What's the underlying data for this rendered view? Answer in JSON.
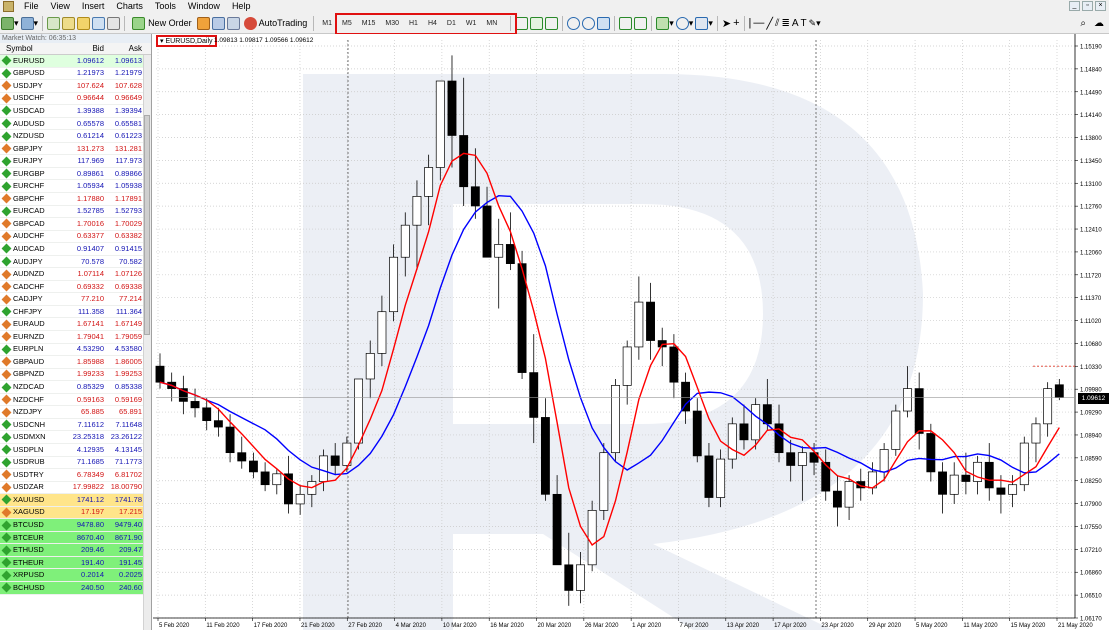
{
  "menu": [
    "File",
    "View",
    "Insert",
    "Charts",
    "Tools",
    "Window",
    "Help"
  ],
  "toolbar": {
    "new_order": "New Order",
    "autotrading": "AutoTrading",
    "timeframes": [
      "M1",
      "M5",
      "M15",
      "M30",
      "H1",
      "H4",
      "D1",
      "W1",
      "MN"
    ]
  },
  "market_watch": {
    "title": "Market Watch: 06:35:13",
    "columns": [
      "Symbol",
      "Bid",
      "Ask"
    ],
    "rows": [
      {
        "symbol": "EURUSD",
        "bid": "1.09612",
        "ask": "1.09613",
        "dir": "up"
      },
      {
        "symbol": "GBPUSD",
        "bid": "1.21973",
        "ask": "1.21979",
        "dir": "up"
      },
      {
        "symbol": "USDJPY",
        "bid": "107.624",
        "ask": "107.628",
        "dir": "down"
      },
      {
        "symbol": "USDCHF",
        "bid": "0.96644",
        "ask": "0.96649",
        "dir": "down"
      },
      {
        "symbol": "USDCAD",
        "bid": "1.39388",
        "ask": "1.39394",
        "dir": "up"
      },
      {
        "symbol": "AUDUSD",
        "bid": "0.65578",
        "ask": "0.65581",
        "dir": "up"
      },
      {
        "symbol": "NZDUSD",
        "bid": "0.61214",
        "ask": "0.61223",
        "dir": "up"
      },
      {
        "symbol": "GBPJPY",
        "bid": "131.273",
        "ask": "131.281",
        "dir": "down"
      },
      {
        "symbol": "EURJPY",
        "bid": "117.969",
        "ask": "117.973",
        "dir": "up"
      },
      {
        "symbol": "EURGBP",
        "bid": "0.89861",
        "ask": "0.89866",
        "dir": "up"
      },
      {
        "symbol": "EURCHF",
        "bid": "1.05934",
        "ask": "1.05938",
        "dir": "up"
      },
      {
        "symbol": "GBPCHF",
        "bid": "1.17880",
        "ask": "1.17891",
        "dir": "down"
      },
      {
        "symbol": "EURCAD",
        "bid": "1.52785",
        "ask": "1.52793",
        "dir": "up"
      },
      {
        "symbol": "GBPCAD",
        "bid": "1.70016",
        "ask": "1.70029",
        "dir": "down"
      },
      {
        "symbol": "AUDCHF",
        "bid": "0.63377",
        "ask": "0.63382",
        "dir": "down"
      },
      {
        "symbol": "AUDCAD",
        "bid": "0.91407",
        "ask": "0.91415",
        "dir": "up"
      },
      {
        "symbol": "AUDJPY",
        "bid": "70.578",
        "ask": "70.582",
        "dir": "up"
      },
      {
        "symbol": "AUDNZD",
        "bid": "1.07114",
        "ask": "1.07126",
        "dir": "down"
      },
      {
        "symbol": "CADCHF",
        "bid": "0.69332",
        "ask": "0.69338",
        "dir": "down"
      },
      {
        "symbol": "CADJPY",
        "bid": "77.210",
        "ask": "77.214",
        "dir": "down"
      },
      {
        "symbol": "CHFJPY",
        "bid": "111.358",
        "ask": "111.364",
        "dir": "up"
      },
      {
        "symbol": "EURAUD",
        "bid": "1.67141",
        "ask": "1.67149",
        "dir": "down"
      },
      {
        "symbol": "EURNZD",
        "bid": "1.79041",
        "ask": "1.79059",
        "dir": "down"
      },
      {
        "symbol": "EURPLN",
        "bid": "4.53290",
        "ask": "4.53580",
        "dir": "up"
      },
      {
        "symbol": "GBPAUD",
        "bid": "1.85988",
        "ask": "1.86005",
        "dir": "down"
      },
      {
        "symbol": "GBPNZD",
        "bid": "1.99233",
        "ask": "1.99253",
        "dir": "down"
      },
      {
        "symbol": "NZDCAD",
        "bid": "0.85329",
        "ask": "0.85338",
        "dir": "up"
      },
      {
        "symbol": "NZDCHF",
        "bid": "0.59163",
        "ask": "0.59169",
        "dir": "down"
      },
      {
        "symbol": "NZDJPY",
        "bid": "65.885",
        "ask": "65.891",
        "dir": "down"
      },
      {
        "symbol": "USDCNH",
        "bid": "7.11612",
        "ask": "7.11648",
        "dir": "up"
      },
      {
        "symbol": "USDMXN",
        "bid": "23.25318",
        "ask": "23.26122",
        "dir": "up"
      },
      {
        "symbol": "USDPLN",
        "bid": "4.12935",
        "ask": "4.13145",
        "dir": "up"
      },
      {
        "symbol": "USDRUB",
        "bid": "71.1685",
        "ask": "71.1773",
        "dir": "up"
      },
      {
        "symbol": "USDTRY",
        "bid": "6.78349",
        "ask": "6.81702",
        "dir": "down"
      },
      {
        "symbol": "USDZAR",
        "bid": "17.99822",
        "ask": "18.00790",
        "dir": "down"
      },
      {
        "symbol": "XAUUSD",
        "bid": "1741.12",
        "ask": "1741.78",
        "dir": "up",
        "style": "gold"
      },
      {
        "symbol": "XAGUSD",
        "bid": "17.197",
        "ask": "17.215",
        "dir": "down",
        "style": "gold"
      },
      {
        "symbol": "BTCUSD",
        "bid": "9478.80",
        "ask": "9479.40",
        "dir": "up",
        "style": "crypto"
      },
      {
        "symbol": "BTCEUR",
        "bid": "8670.40",
        "ask": "8671.90",
        "dir": "up",
        "style": "crypto"
      },
      {
        "symbol": "ETHUSD",
        "bid": "209.46",
        "ask": "209.47",
        "dir": "up",
        "style": "crypto"
      },
      {
        "symbol": "ETHEUR",
        "bid": "191.40",
        "ask": "191.45",
        "dir": "up",
        "style": "crypto"
      },
      {
        "symbol": "XRPUSD",
        "bid": "0.2014",
        "ask": "0.2025",
        "dir": "up",
        "style": "crypto"
      },
      {
        "symbol": "BCHUSD",
        "bid": "240.50",
        "ask": "240.60",
        "dir": "up",
        "style": "crypto"
      }
    ]
  },
  "chart": {
    "legend": "EURUSD,Daily",
    "ohlc_header": "1.09813 1.09817 1.09566 1.09612",
    "current_price": "1.09612",
    "bid_color": "#1414b4",
    "ask_color": "#d21414"
  },
  "chart_data": {
    "type": "candlestick",
    "symbol": "EURUSD",
    "timeframe": "Daily",
    "price_ticks": [
      "1.15190",
      "1.14840",
      "1.14490",
      "1.14140",
      "1.13800",
      "1.13450",
      "1.13100",
      "1.12760",
      "1.12410",
      "1.12060",
      "1.11720",
      "1.11370",
      "1.11020",
      "1.10680",
      "1.10330",
      "1.09980",
      "1.09290",
      "1.08940",
      "1.08590",
      "1.08250",
      "1.07900",
      "1.07550",
      "1.07210",
      "1.06860",
      "1.06510",
      "1.06170"
    ],
    "date_ticks": [
      "5 Feb 2020",
      "11 Feb 2020",
      "17 Feb 2020",
      "21 Feb 2020",
      "27 Feb 2020",
      "4 Mar 2020",
      "10 Mar 2020",
      "16 Mar 2020",
      "20 Mar 2020",
      "26 Mar 2020",
      "1 Apr 2020",
      "7 Apr 2020",
      "13 Apr 2020",
      "17 Apr 2020",
      "23 Apr 2020",
      "29 Apr 2020",
      "5 May 2020",
      "11 May 2020",
      "15 May 2020",
      "21 May 2020"
    ],
    "ylim": [
      1.0617,
      1.1519
    ],
    "last_price": 1.09612,
    "ma_colors": [
      "#ff0000",
      "#0000ff"
    ]
  }
}
